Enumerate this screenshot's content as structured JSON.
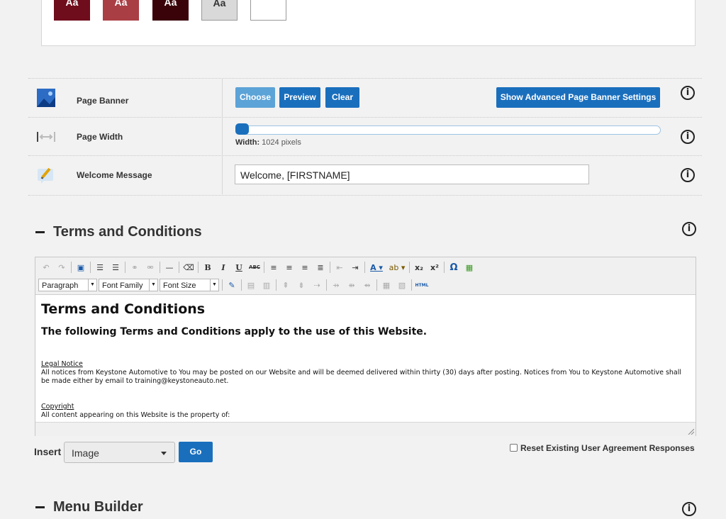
{
  "theme": {
    "swatches": [
      {
        "label": "Aa",
        "color": "#6f0d1c"
      },
      {
        "label": "Aa",
        "color": "#a93e44"
      },
      {
        "label": "Aa",
        "color": "#3a0309"
      },
      {
        "label": "Aa",
        "color": "#d9d9d9"
      },
      {
        "label": "",
        "color": "#ffffff"
      }
    ]
  },
  "settings": {
    "page_banner": {
      "label": "Page Banner",
      "icon": "image-icon",
      "choose": "Choose",
      "preview": "Preview",
      "clear": "Clear",
      "advanced": "Show Advanced Page Banner Settings"
    },
    "page_width": {
      "label": "Page Width",
      "icon": "resize-width-icon",
      "width_label": "Width:",
      "width_value": "1024 pixels",
      "slider_fraction": 0.0
    },
    "welcome": {
      "label": "Welcome Message",
      "icon": "pencil-message-icon",
      "value": "Welcome, [FIRSTNAME]"
    }
  },
  "terms": {
    "heading": "Terms and Conditions",
    "toolbar": {
      "paragraph": "Paragraph",
      "font_family": "Font Family",
      "font_size": "Font Size",
      "html_label": "HTML"
    },
    "content": {
      "h1": "Terms and Conditions",
      "h3": "The following Terms and Conditions apply to the use of this Website.",
      "legal_title": "Legal Notice",
      "legal_text": "All notices from Keystone Automotive to You may be posted on our Website and will be deemed delivered within thirty (30) days after posting. Notices from You to Keystone Automotive shall be made either by email to training@keystoneauto.net.",
      "copyright_title": "Copyright",
      "copyright_text": "All content appearing on this Website is the property of:"
    },
    "insert_label": "Insert",
    "insert_value": "Image",
    "go": "Go",
    "reset_label": "Reset Existing User Agreement Responses"
  },
  "menu_builder": {
    "heading": "Menu Builder"
  },
  "colors": {
    "primary_blue": "#1a6fbd",
    "light_blue": "#5ca3d7"
  }
}
